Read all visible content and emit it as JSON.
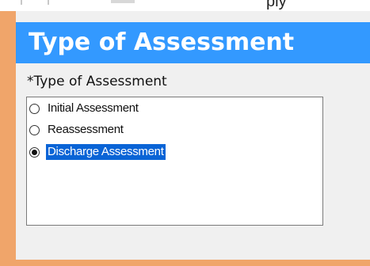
{
  "top_strip": {
    "partial_text": "ply"
  },
  "header": {
    "title": "Type of Assessment"
  },
  "field": {
    "label": "*Type of Assessment"
  },
  "options": [
    {
      "label": "Initial Assessment",
      "checked": false
    },
    {
      "label": "Reassessment",
      "checked": false
    },
    {
      "label": "Discharge Assessment",
      "checked": true
    }
  ],
  "colors": {
    "frame_orange": "#f0a56a",
    "header_blue": "#3399ff",
    "selection_blue": "#0a64d6",
    "panel_gray": "#f0f0f0"
  }
}
